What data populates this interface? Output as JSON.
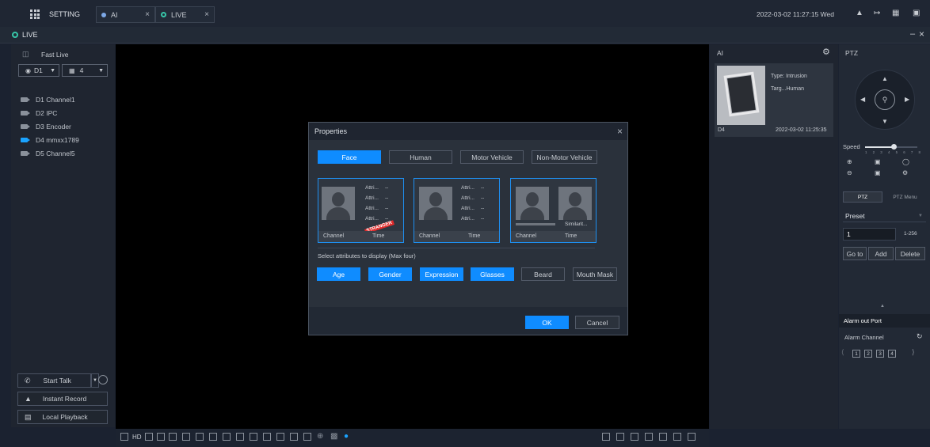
{
  "topbar": {
    "setting_label": "SETTING",
    "tabs": [
      {
        "label": "AI",
        "close": "×"
      },
      {
        "label": "LIVE",
        "close": "×"
      }
    ],
    "datetime": "2022-03-02 11:27:15 Wed"
  },
  "livebar": {
    "title": "LIVE",
    "minimize": "–",
    "close": "×"
  },
  "left": {
    "fast_live": "Fast Live",
    "group_select": "D1",
    "layout_select": "4",
    "channels": [
      {
        "label": "D1 Channel1",
        "active": false
      },
      {
        "label": "D2 IPC",
        "active": false
      },
      {
        "label": "D3 Encoder",
        "active": false
      },
      {
        "label": "D4 mmxx1789",
        "active": true
      },
      {
        "label": "D5 Channel5",
        "active": false
      }
    ],
    "start_talk": "Start Talk",
    "instant_record": "Instant Record",
    "local_playback": "Local Playback"
  },
  "bottom": {
    "hd_label": "HD"
  },
  "ai": {
    "title": "AI",
    "event": {
      "type": "Type:  Intrusion",
      "target": "Targ...Human",
      "channel": "D4",
      "time": "2022-03-02 11:25:35"
    }
  },
  "ptz": {
    "title": "PTZ",
    "speed_label": "Speed",
    "speed_ticks": [
      "1",
      "2",
      "3",
      "4",
      "5",
      "6",
      "7",
      "8"
    ],
    "speed_value": 5,
    "tabs": [
      "PTZ",
      "PTZ Menu"
    ],
    "preset_label": "Preset",
    "preset_value": "1",
    "preset_range": "1-256",
    "goto": "Go to",
    "add": "Add",
    "delete": "Delete",
    "alarm_title": "Alarm out Port",
    "alarm_channel": "Alarm Channel",
    "alarm_numbers": [
      "1",
      "2",
      "3",
      "4"
    ]
  },
  "dialog": {
    "title": "Properties",
    "close": "×",
    "types": [
      {
        "label": "Face",
        "on": true
      },
      {
        "label": "Human",
        "on": false
      },
      {
        "label": "Motor Vehicle",
        "on": false
      },
      {
        "label": "Non-Motor Vehicle",
        "on": false
      }
    ],
    "card_attr": "Attri...",
    "card_dash": "--",
    "card_channel": "Channel",
    "card_time": "Time",
    "stranger": "STRANGER",
    "similarity": "Similarit...",
    "select_text": "Select attributes to display (Max four)",
    "attributes": [
      {
        "label": "Age",
        "on": true
      },
      {
        "label": "Gender",
        "on": true
      },
      {
        "label": "Expression",
        "on": true
      },
      {
        "label": "Glasses",
        "on": true
      },
      {
        "label": "Beard",
        "on": false
      },
      {
        "label": "Mouth Mask",
        "on": false
      }
    ],
    "ok": "OK",
    "cancel": "Cancel"
  },
  "colors": {
    "accent": "#0f8cff",
    "stranger": "#e02a2a"
  }
}
